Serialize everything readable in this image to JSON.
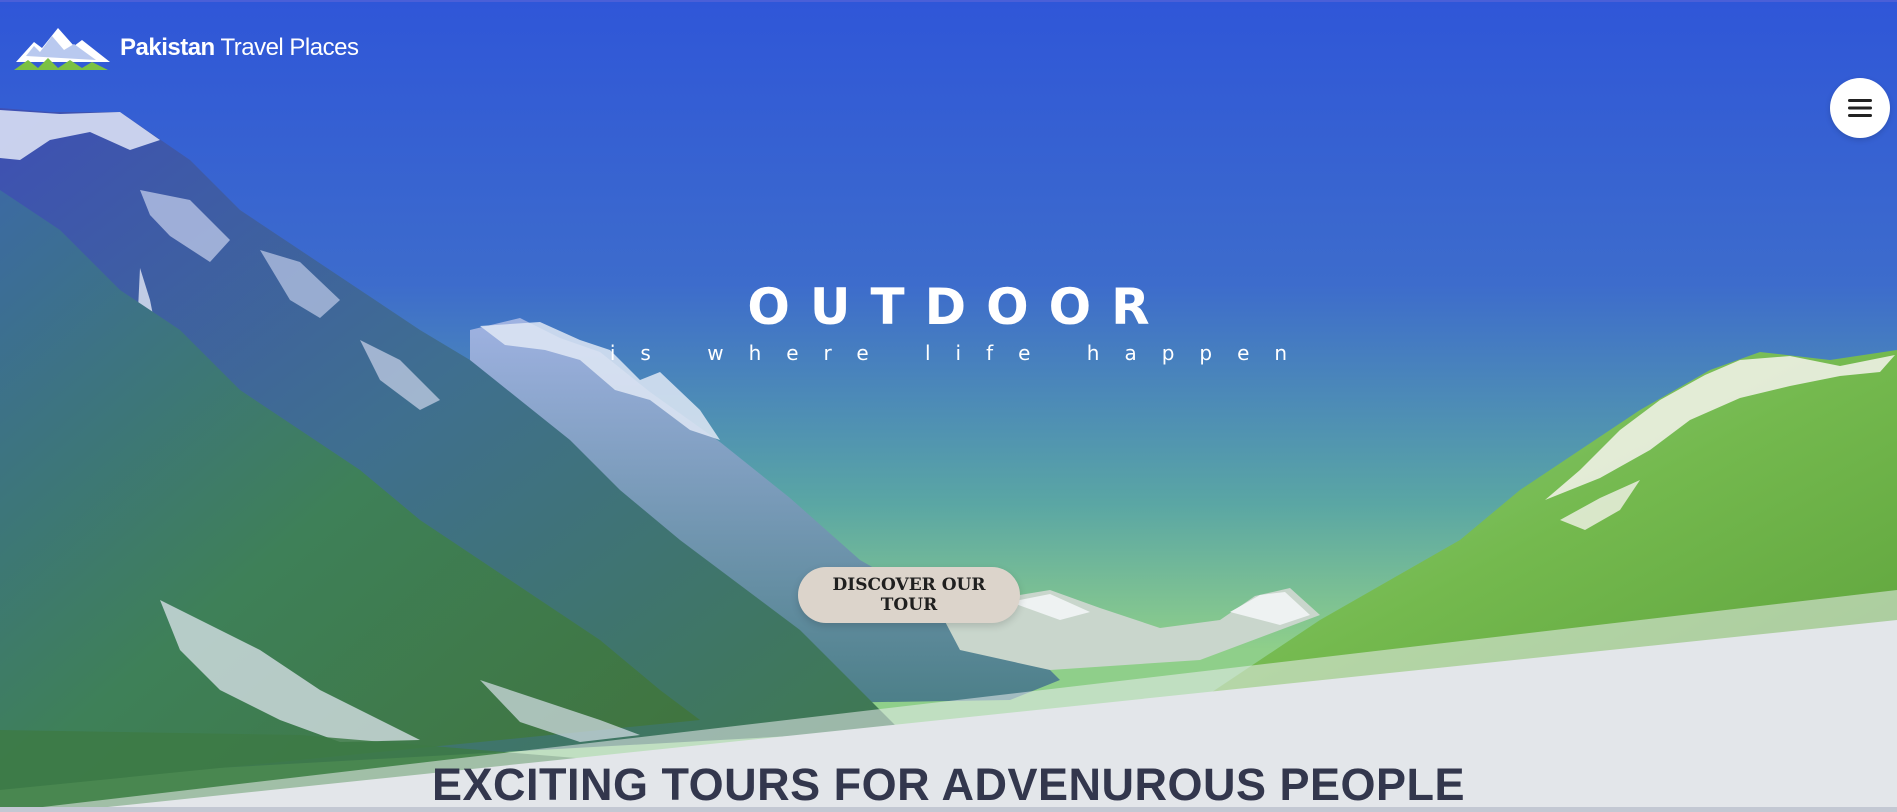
{
  "brand": {
    "name_bold": "Pakistan",
    "name_rest": " Travel Places",
    "logo_icon": "mountain-logo-icon"
  },
  "menu": {
    "icon": "hamburger-menu-icon"
  },
  "hero": {
    "title": "OUTDOOR",
    "subtitle": "is where life happen",
    "cta_label": "DISCOVER OUR TOUR"
  },
  "section": {
    "heading": "EXCITING TOURS FOR ADVENUROUS PEOPLE"
  },
  "colors": {
    "sky_top": "#2f56d8",
    "sky_bottom": "#64b79a",
    "grass": "#79c448",
    "cta_background": "#dcd4cb",
    "heading_text": "#33374d",
    "section_background": "#e3e6ea"
  }
}
